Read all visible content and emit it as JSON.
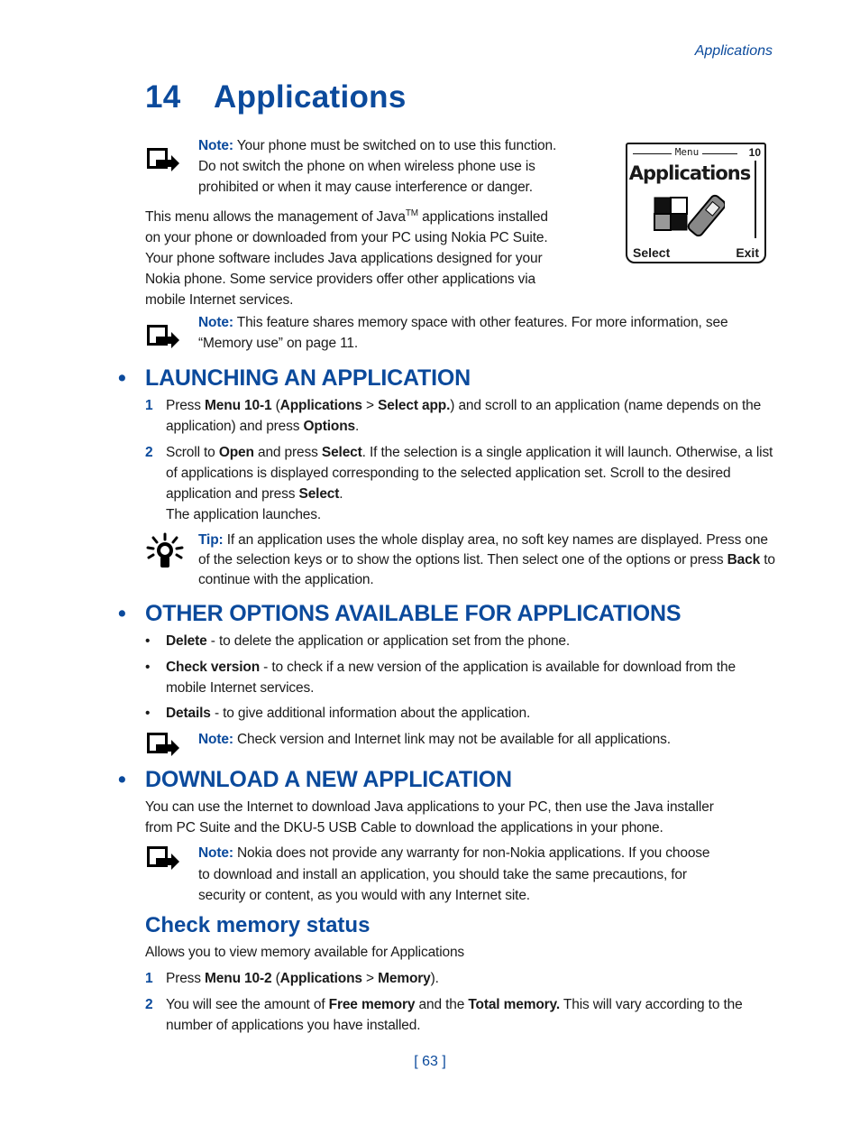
{
  "running_head": "Applications",
  "chapter": {
    "number": "14",
    "title": "Applications"
  },
  "intro_note": {
    "label": "Note:",
    "lines": [
      "Your phone must be switched on to use this function.",
      "Do not switch the phone on when wireless phone use is",
      "prohibited or when it may cause interference or danger."
    ]
  },
  "intro_paragraph": {
    "line1_before": "This menu allows the management of Java",
    "line1_sup": "TM",
    "line1_after": " applications installed",
    "lines": [
      "on your phone or downloaded from your PC using Nokia PC Suite.",
      "Your phone software includes Java applications designed for your",
      "Nokia phone. Some service providers offer other applications via",
      "mobile Internet services."
    ]
  },
  "phone_screen": {
    "header": "Menu",
    "index": "10",
    "title": "Applications",
    "left_softkey": "Select",
    "right_softkey": "Exit"
  },
  "memory_note": {
    "label": "Note:",
    "lines": [
      "This feature shares memory space with other features. For more information, see",
      "“Memory use” on page 11."
    ]
  },
  "section_launching": {
    "bullet": "•",
    "title": "LAUNCHING AN APPLICATION",
    "steps": [
      {
        "n": "1",
        "parts": [
          "Press ",
          "Menu 10-1",
          " (",
          "Applications",
          " > ",
          "Select app.",
          ") and scroll to an application (name depends on the application) and press ",
          "Options",
          "."
        ]
      },
      {
        "n": "2",
        "parts": [
          "Scroll to ",
          "Open",
          " and press ",
          "Select",
          ". If the selection is a single application it will launch. Otherwise, a list of applications is displayed corresponding to the selected application set. Scroll to the desired application and press ",
          "Select",
          "."
        ],
        "extra_line": "The application launches."
      }
    ],
    "tip": {
      "label": "Tip:",
      "text_before": " If an application uses the whole display area, no soft key names are displayed. Press one of the selection keys or to show the options list. Then select one of the options or press ",
      "bold": "Back",
      "text_after": " to continue with the application."
    }
  },
  "section_options": {
    "bullet": "•",
    "title": "OTHER OPTIONS AVAILABLE FOR APPLICATIONS",
    "items": [
      {
        "term": "Delete",
        "desc": " - to delete the application or application set from the phone."
      },
      {
        "term": "Check version",
        "desc": " - to check if a new version of the application is available for download from the mobile Internet services."
      },
      {
        "term": "Details",
        "desc": " - to give additional information about the application."
      }
    ],
    "note": {
      "label": "Note:",
      "text": " Check version and Internet link may not be available for all applications."
    }
  },
  "section_download": {
    "bullet": "•",
    "title": "DOWNLOAD A NEW APPLICATION",
    "lines": [
      "You can use the Internet to download Java applications to your PC, then use the Java installer",
      "from PC Suite and the DKU-5 USB Cable to download the applications in your phone."
    ],
    "note": {
      "label": "Note:",
      "lines": [
        " Nokia does not provide any warranty for non-Nokia applications. If you choose",
        "to download and install an application, you should take the same precautions, for",
        "security or content, as you would with any Internet site."
      ]
    }
  },
  "section_memory": {
    "title": "Check memory status",
    "intro": "Allows you to view memory available for Applications",
    "steps": [
      {
        "n": "1",
        "parts": [
          "Press ",
          "Menu 10-2",
          " (",
          "Applications",
          " > ",
          "Memory",
          ")."
        ]
      },
      {
        "n": "2",
        "parts": [
          "You will see the amount of ",
          "Free memory",
          " and the ",
          "Total memory.",
          " This will vary according to the number of applications you have installed."
        ]
      }
    ]
  },
  "page_number": "[ 63 ]"
}
